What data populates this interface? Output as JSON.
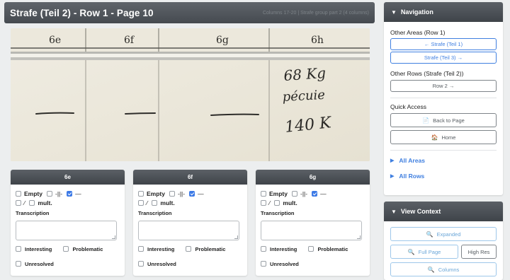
{
  "header": {
    "title": "Strafe (Teil 2) - Row 1 - Page 10",
    "meta": "Columns 17-20 | Strafe group part 2 (4 columns)"
  },
  "scan": {
    "column_headers": [
      "6e",
      "6f",
      "6g",
      "6h"
    ],
    "handwriting": [
      "68 Kg",
      "pécuie",
      "140 K"
    ]
  },
  "cards": [
    {
      "title": "6e",
      "options": [
        {
          "label": "Empty",
          "checked": false
        },
        {
          "label": "-||-",
          "checked": false
        },
        {
          "label": "—",
          "checked": true
        },
        {
          "label": "⁄",
          "checked": false
        },
        {
          "label": "mult.",
          "checked": false
        }
      ],
      "transcription_label": "Transcription",
      "transcription_value": "",
      "flags": [
        "Interesting",
        "Problematic",
        "Unresolved"
      ]
    },
    {
      "title": "6f",
      "options": [
        {
          "label": "Empty",
          "checked": false
        },
        {
          "label": "-||-",
          "checked": false
        },
        {
          "label": "—",
          "checked": true
        },
        {
          "label": "⁄",
          "checked": false
        },
        {
          "label": "mult.",
          "checked": false
        }
      ],
      "transcription_label": "Transcription",
      "transcription_value": "",
      "flags": [
        "Interesting",
        "Problematic",
        "Unresolved"
      ]
    },
    {
      "title": "6g",
      "options": [
        {
          "label": "Empty",
          "checked": false
        },
        {
          "label": "-||-",
          "checked": false
        },
        {
          "label": "—",
          "checked": true
        },
        {
          "label": "⁄",
          "checked": false
        },
        {
          "label": "mult.",
          "checked": false
        }
      ],
      "transcription_label": "Transcription",
      "transcription_value": "",
      "flags": [
        "Interesting",
        "Problematic",
        "Unresolved"
      ]
    }
  ],
  "navigation": {
    "title": "Navigation",
    "other_areas_title": "Other Areas (Row 1)",
    "prev_area": "← Strafe (Teil 1)",
    "next_area": "Strafe (Teil 3) →",
    "other_rows_title": "Other Rows (Strafe (Teil 2))",
    "next_row": "Row 2 →",
    "quick_access_title": "Quick Access",
    "back_to_page": "Back to Page",
    "home": "Home",
    "all_areas": "All Areas",
    "all_rows": "All Rows"
  },
  "view_context": {
    "title": "View Context",
    "expanded": "Expanded",
    "full_page": "Full Page",
    "high_res": "High Res",
    "columns": "Columns"
  },
  "colors": {
    "accent": "#3f7fe0",
    "header_dark": "#454a50",
    "checked": "#3d7ae6"
  }
}
